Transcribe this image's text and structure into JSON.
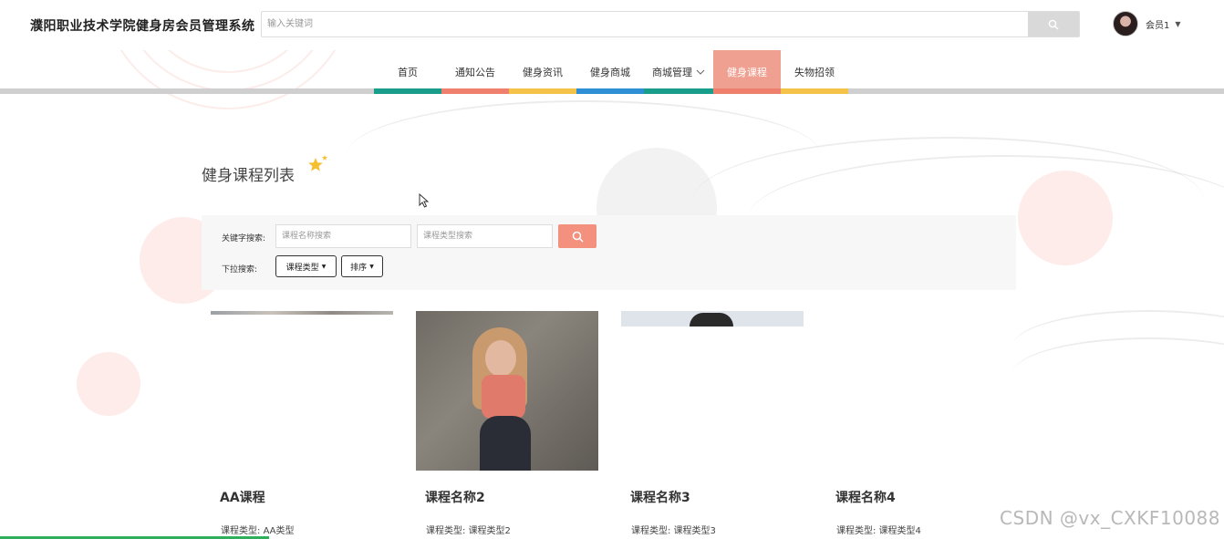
{
  "header": {
    "site_title": "濮阳职业技术学院健身房会员管理系统",
    "search_placeholder": "输入关键词",
    "user_name": "会员1",
    "icons": {
      "search": "search-icon",
      "caret": "caret-down-icon",
      "avatar": "avatar"
    }
  },
  "nav": {
    "items": [
      {
        "label": "首页",
        "color": "#1a9e8c"
      },
      {
        "label": "通知公告",
        "color": "#f0806e"
      },
      {
        "label": "健身资讯",
        "color": "#f5c24a"
      },
      {
        "label": "健身商城",
        "color": "#2f8fd6"
      },
      {
        "label": "商城管理",
        "color": "#1a9e8c",
        "has_dropdown": true
      },
      {
        "label": "健身课程",
        "color": "#f0806e",
        "active": true
      },
      {
        "label": "失物招领",
        "color": "#f5c24a"
      }
    ]
  },
  "main": {
    "title": "健身课程列表",
    "filter": {
      "keyword_label": "关键字搜索:",
      "name_placeholder": "课程名称搜索",
      "type_placeholder": "课程类型搜索",
      "dropdown_label": "下拉搜索:",
      "type_select": "课程类型",
      "sort_select": "排序"
    },
    "cards": [
      {
        "title": "AA课程",
        "type_label": "课程类型:",
        "type_value": "AA类型"
      },
      {
        "title": "课程名称2",
        "type_label": "课程类型:",
        "type_value": "课程类型2"
      },
      {
        "title": "课程名称3",
        "type_label": "课程类型:",
        "type_value": "课程类型3"
      },
      {
        "title": "课程名称4",
        "type_label": "课程类型:",
        "type_value": "课程类型4"
      }
    ]
  },
  "watermark": "CSDN @vx_CXKF10088",
  "colors": {
    "accent": "#f0a090",
    "search_btn": "#f3907e"
  }
}
